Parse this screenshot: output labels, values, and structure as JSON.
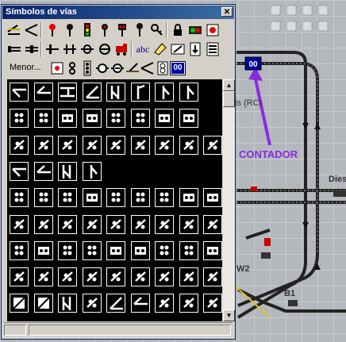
{
  "window": {
    "title": "Símbolos de vías",
    "close_label": "✕"
  },
  "toolbar": {
    "row1_icons": [
      "rails-straight-icon",
      "rails-switch-icon",
      "signal-red-icon",
      "signal-dark-icon",
      "signal-three-light-icon",
      "signal-dwarf-icon",
      "signal-dual-icon",
      "crossing-light-icon",
      "key-icon",
      "lock-icon",
      "signal-pair-icon",
      "red-button-icon"
    ],
    "row2_icons": [
      "buffer-icon",
      "buffer-double-icon",
      "uncoupler-icon",
      "turntable-icon",
      "bridge-icon",
      "rail-break-icon",
      "locomotive-icon",
      "text-tool-icon",
      "eraser-icon",
      "cross-out-icon",
      "down-arrow-icon",
      "block-list-icon"
    ],
    "row3_label": "Menor...",
    "row3_icons": [
      "red-dot-icon",
      "two-lamp-icon",
      "three-lamp-icon",
      "cross-signal-icon",
      "cross-signal-2-icon",
      "switch-left-icon",
      "switch-right-icon",
      "block-indicator-icon",
      "counter-display-icon"
    ],
    "counter_text": "00",
    "text_tool_label": "abc"
  },
  "background": {
    "counter_text": "00",
    "label_rc": "is (RC)",
    "label_dies": "Dies",
    "label_w2": "W2",
    "label_b1": "B1",
    "annotation": "CONTADOR"
  },
  "colors": {
    "title_bg": "#0a246a",
    "window_bg": "#d4d0c8",
    "grid_bg": "#000000",
    "annotation": "#8a2be2",
    "counter_bg": "#0000a0"
  }
}
